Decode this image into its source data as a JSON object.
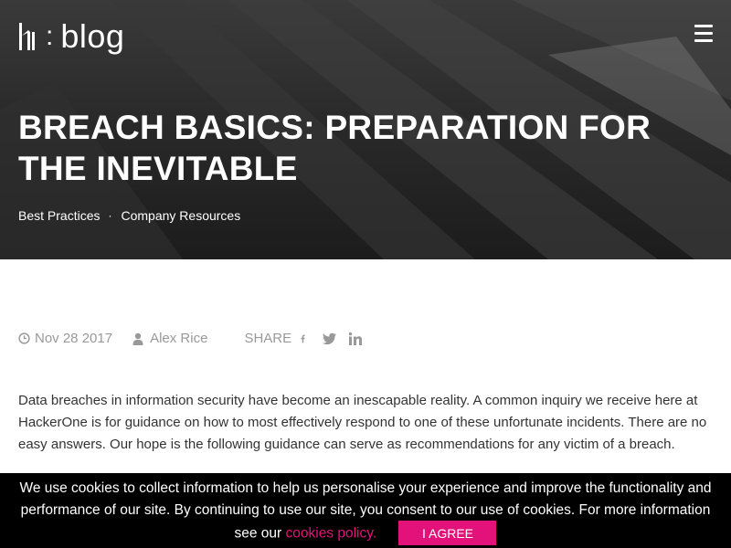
{
  "header": {
    "logo_text": "blog",
    "logo_separator": ":"
  },
  "hero": {
    "title": "BREACH BASICS: PREPARATION FOR THE INEVITABLE",
    "tags": [
      "Best Practices",
      "Company Resources"
    ],
    "tag_separator": "·"
  },
  "meta": {
    "date": "Nov 28 2017",
    "author": "Alex Rice",
    "share_label": "SHARE"
  },
  "article": {
    "intro": "Data breaches in information security have become an inescapable reality. A common inquiry we receive here at HackerOne is for guidance on how to most effectively respond to one of these unfortunate incidents. There are no easy answers. Our hope is the following guidance can serve as recommendations for any victim of a breach."
  },
  "cookie_banner": {
    "text": "We use cookies to collect information to help us personalise your experience and improve the functionality and performance of our site. By continuing to use our site, you consent to our use of cookies. For more information see our",
    "link_text": "cookies policy.",
    "button_label": "I AGREE"
  },
  "colors": {
    "accent": "#e3127a",
    "meta_gray": "#999999"
  }
}
